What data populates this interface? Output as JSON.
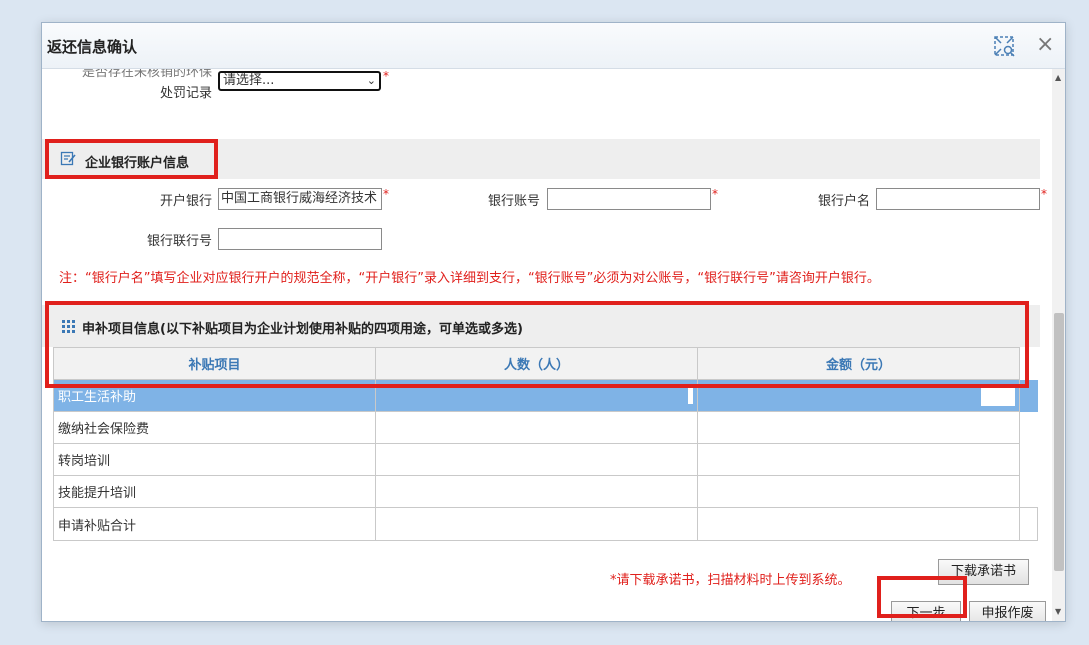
{
  "dialog": {
    "title": "返还信息确认",
    "maximize_icon": "maximize-icon",
    "close_icon": "×"
  },
  "penalty": {
    "label_line1": "是否存在未核销的环保",
    "label_line2": "处罚记录",
    "select_value": "请选择...",
    "required_mark": "*"
  },
  "bank_section": {
    "title": "企业银行账户信息",
    "open_bank_label": "开户银行",
    "open_bank_value": "中国工商银行威海经济技术",
    "account_no_label": "银行账号",
    "account_no_value": "",
    "account_name_label": "银行户名",
    "account_name_value": "",
    "routing_no_label": "银行联行号",
    "routing_no_value": "",
    "required_mark": "*",
    "note": "注：“银行户名”填写企业对应银行开户的规范全称，“开户银行”录入详细到支行，“银行账号”必须为对公账号，“银行联行号”请咨询开户银行。"
  },
  "subsidy_section": {
    "title": "申补项目信息(以下补贴项目为企业计划使用补贴的四项用途，可单选或多选)",
    "columns": [
      "补贴项目",
      "人数（人）",
      "金额（元）"
    ],
    "rows": [
      {
        "item": "职工生活补助",
        "people": "",
        "amount": ""
      },
      {
        "item": "缴纳社会保险费",
        "people": "",
        "amount": ""
      },
      {
        "item": "转岗培训",
        "people": "",
        "amount": ""
      },
      {
        "item": "技能提升培训",
        "people": "",
        "amount": ""
      }
    ],
    "total_label": "申请补贴合计",
    "selected_row": 0
  },
  "footer": {
    "warning": "*请下载承诺书，扫描材料时上传到系统。",
    "download_button": "下载承诺书",
    "next_button": "下一步",
    "void_button": "申报作废"
  },
  "colors": {
    "highlight_red": "#e0201c",
    "header_blue": "#3b78b5",
    "selected_row": "#7fb3e6"
  }
}
